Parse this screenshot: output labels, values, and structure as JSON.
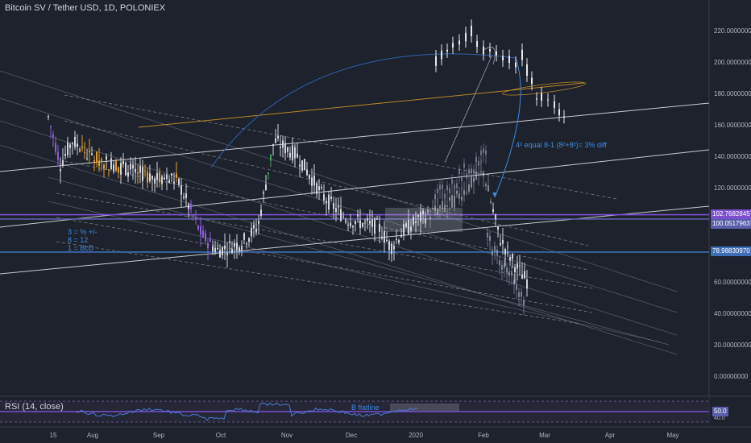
{
  "title": "Bitcoin SV / Tether USD, 1D, POLONIEX",
  "price_axis": {
    "ticks": [
      "220.00000000",
      "200.00000000",
      "180.00000000",
      "160.00000000",
      "140.00000000",
      "120.00000000",
      "60.00000000",
      "40.00000000",
      "20.00000000",
      "0.00000000"
    ],
    "tick_values": [
      220,
      200,
      180,
      160,
      140,
      120,
      60,
      40,
      20,
      0
    ],
    "tags": [
      {
        "text": "102.76828457",
        "value": 102.77,
        "color": "#7b4fcf"
      },
      {
        "text": "100.05179637",
        "value": 100.05,
        "color": "#5a5ea8"
      },
      {
        "text": "78.98830970",
        "value": 78.99,
        "color": "#3c6db5"
      }
    ]
  },
  "time_axis": [
    "15",
    "Aug",
    "Sep",
    "Oct",
    "Nov",
    "Dec",
    "2020",
    "Feb",
    "Mar",
    "Apr",
    "May"
  ],
  "annotations": {
    "formula": "4² equal 8-1 (8²+8²)= 3% diff",
    "legend_lines": [
      "3 = % +/-",
      "8 = 12",
      "1 = BcD"
    ]
  },
  "rsi": {
    "title": "RSI (14, close)",
    "value_tag": "50.0",
    "level_tag": "40.0",
    "note": "B flatline"
  },
  "colors": {
    "background": "#1e222d",
    "candles": "#d1d4dc",
    "highlight_orange": "#e0a030",
    "highlight_purple": "#8d5fd9",
    "highlight_green": "#3aa35a",
    "annotation_blue": "#3d8be0",
    "rsi_line": "#4d7bd3"
  },
  "chart_data": {
    "type": "candlestick",
    "symbol": "Bitcoin SV / Tether USD, 1D, POLONIEX",
    "ylim": [
      0,
      225
    ],
    "price_levels": [
      102.77,
      100.05,
      78.99
    ],
    "close_path": [
      {
        "t": "15",
        "close": 165
      },
      {
        "t": "Jul-late",
        "close": 130
      },
      {
        "t": "Aug",
        "close": 135
      },
      {
        "t": "Aug-mid",
        "close": 128
      },
      {
        "t": "Sep",
        "close": 125
      },
      {
        "t": "Sep-mid",
        "close": 85
      },
      {
        "t": "Oct",
        "close": 82
      },
      {
        "t": "Oct-late",
        "close": 95
      },
      {
        "t": "Nov",
        "close": 145
      },
      {
        "t": "Nov-mid",
        "close": 115
      },
      {
        "t": "Dec",
        "close": 95
      },
      {
        "t": "Dec-late",
        "close": 85
      },
      {
        "t": "2020",
        "close": 100
      },
      {
        "t": "Jan-mid",
        "close": 200
      },
      {
        "t": "Feb",
        "close": 205
      },
      {
        "t": "Feb-mid",
        "close": 200
      },
      {
        "t": "Mar",
        "close": 165
      }
    ]
  }
}
